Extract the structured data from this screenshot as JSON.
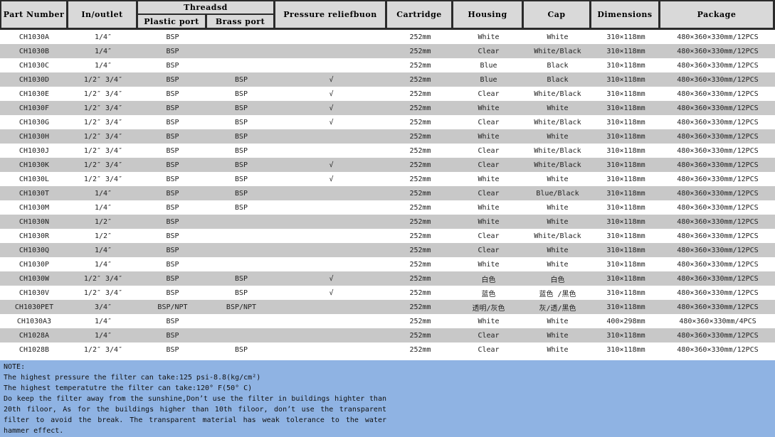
{
  "table": {
    "headers": {
      "part_number": "Part Number",
      "inlet_outlet": "In/outlet",
      "threads_group": "Threadsd",
      "plastic_port": "Plastic port",
      "brass_port": "Brass port",
      "pressure_relief": "Pressure reliefbuon",
      "cartridge": "Cartridge",
      "housing": "Housing",
      "cap": "Cap",
      "dimensions": "Dimensions",
      "package": "Package"
    },
    "rows": [
      {
        "part": "CH1030A",
        "io": "1/4″",
        "plastic": "BSP",
        "brass": "",
        "relief": "",
        "cartridge": "252mm",
        "housing": "White",
        "cap": "White",
        "dimensions": "310×118mm",
        "package": "480×360×330mm/12PCS"
      },
      {
        "part": "CH1030B",
        "io": "1/4″",
        "plastic": "BSP",
        "brass": "",
        "relief": "",
        "cartridge": "252mm",
        "housing": "Clear",
        "cap": "White/Black",
        "dimensions": "310×118mm",
        "package": "480×360×330mm/12PCS"
      },
      {
        "part": "CH1030C",
        "io": "1/4″",
        "plastic": "BSP",
        "brass": "",
        "relief": "",
        "cartridge": "252mm",
        "housing": "Blue",
        "cap": "Black",
        "dimensions": "310×118mm",
        "package": "480×360×330mm/12PCS"
      },
      {
        "part": "CH1030D",
        "io": "1/2″  3/4″",
        "plastic": "BSP",
        "brass": "BSP",
        "relief": "√",
        "cartridge": "252mm",
        "housing": "Blue",
        "cap": "Black",
        "dimensions": "310×118mm",
        "package": "480×360×330mm/12PCS"
      },
      {
        "part": "CH1030E",
        "io": "1/2″  3/4″",
        "plastic": "BSP",
        "brass": "BSP",
        "relief": "√",
        "cartridge": "252mm",
        "housing": "Clear",
        "cap": "White/Black",
        "dimensions": "310×118mm",
        "package": "480×360×330mm/12PCS"
      },
      {
        "part": "CH1030F",
        "io": "1/2″  3/4″",
        "plastic": "BSP",
        "brass": "BSP",
        "relief": "√",
        "cartridge": "252mm",
        "housing": "White",
        "cap": "White",
        "dimensions": "310×118mm",
        "package": "480×360×330mm/12PCS"
      },
      {
        "part": "CH1030G",
        "io": "1/2″  3/4″",
        "plastic": "BSP",
        "brass": "BSP",
        "relief": "√",
        "cartridge": "252mm",
        "housing": "Clear",
        "cap": "White/Black",
        "dimensions": "310×118mm",
        "package": "480×360×330mm/12PCS"
      },
      {
        "part": "CH1030H",
        "io": "1/2″  3/4″",
        "plastic": "BSP",
        "brass": "BSP",
        "relief": "",
        "cartridge": "252mm",
        "housing": "White",
        "cap": "White",
        "dimensions": "310×118mm",
        "package": "480×360×330mm/12PCS"
      },
      {
        "part": "CH1030J",
        "io": "1/2″  3/4″",
        "plastic": "BSP",
        "brass": "BSP",
        "relief": "",
        "cartridge": "252mm",
        "housing": "Clear",
        "cap": "White/Black",
        "dimensions": "310×118mm",
        "package": "480×360×330mm/12PCS"
      },
      {
        "part": "CH1030K",
        "io": "1/2″  3/4″",
        "plastic": "BSP",
        "brass": "BSP",
        "relief": "√",
        "cartridge": "252mm",
        "housing": "Clear",
        "cap": "White/Black",
        "dimensions": "310×118mm",
        "package": "480×360×330mm/12PCS"
      },
      {
        "part": "CH1030L",
        "io": "1/2″  3/4″",
        "plastic": "BSP",
        "brass": "BSP",
        "relief": "√",
        "cartridge": "252mm",
        "housing": "White",
        "cap": "White",
        "dimensions": "310×118mm",
        "package": "480×360×330mm/12PCS"
      },
      {
        "part": "CH1030T",
        "io": "1/4″",
        "plastic": "BSP",
        "brass": "BSP",
        "relief": "",
        "cartridge": "252mm",
        "housing": "Clear",
        "cap": "Blue/Black",
        "dimensions": "310×118mm",
        "package": "480×360×330mm/12PCS"
      },
      {
        "part": "CH1030M",
        "io": "1/4″",
        "plastic": "BSP",
        "brass": "BSP",
        "relief": "",
        "cartridge": "252mm",
        "housing": "White",
        "cap": "White",
        "dimensions": "310×118mm",
        "package": "480×360×330mm/12PCS"
      },
      {
        "part": "CH1030N",
        "io": "1/2″",
        "plastic": "BSP",
        "brass": "",
        "relief": "",
        "cartridge": "252mm",
        "housing": "White",
        "cap": "White",
        "dimensions": "310×118mm",
        "package": "480×360×330mm/12PCS"
      },
      {
        "part": "CH1030R",
        "io": "1/2″",
        "plastic": "BSP",
        "brass": "",
        "relief": "",
        "cartridge": "252mm",
        "housing": "Clear",
        "cap": "White/Black",
        "dimensions": "310×118mm",
        "package": "480×360×330mm/12PCS"
      },
      {
        "part": "CH1030Q",
        "io": "1/4″",
        "plastic": "BSP",
        "brass": "",
        "relief": "",
        "cartridge": "252mm",
        "housing": "Clear",
        "cap": "White",
        "dimensions": "310×118mm",
        "package": "480×360×330mm/12PCS"
      },
      {
        "part": "CH1030P",
        "io": "1/4″",
        "plastic": "BSP",
        "brass": "",
        "relief": "",
        "cartridge": "252mm",
        "housing": "White",
        "cap": "White",
        "dimensions": "310×118mm",
        "package": "480×360×330mm/12PCS"
      },
      {
        "part": "CH1030W",
        "io": "1/2″  3/4″",
        "plastic": "BSP",
        "brass": "BSP",
        "relief": "√",
        "cartridge": "252mm",
        "housing": "白色",
        "cap": "白色",
        "dimensions": "310×118mm",
        "package": "480×360×330mm/12PCS"
      },
      {
        "part": "CH1030V",
        "io": "1/2″  3/4″",
        "plastic": "BSP",
        "brass": "BSP",
        "relief": "√",
        "cartridge": "252mm",
        "housing": "蓝色",
        "cap": "蓝色 /黑色",
        "dimensions": "310×118mm",
        "package": "480×360×330mm/12PCS"
      },
      {
        "part": "CH1030PET",
        "io": "3/4″",
        "plastic": "BSP/NPT",
        "brass": "BSP/NPT",
        "relief": "",
        "cartridge": "252mm",
        "housing": "透明/灰色",
        "cap": "灰/透/黑色",
        "dimensions": "310×118mm",
        "package": "480×360×330mm/12PCS"
      },
      {
        "part": "CH1030A3",
        "io": "1/4″",
        "plastic": "BSP",
        "brass": "",
        "relief": "",
        "cartridge": "252mm",
        "housing": "White",
        "cap": "White",
        "dimensions": "400×298mm",
        "package": "480×360×330mm/4PCS"
      },
      {
        "part": "CH1028A",
        "io": "1/4″",
        "plastic": "BSP",
        "brass": "",
        "relief": "",
        "cartridge": "252mm",
        "housing": "Clear",
        "cap": "White",
        "dimensions": "310×118mm",
        "package": "480×360×330mm/12PCS"
      },
      {
        "part": "CH1028B",
        "io": "1/2″  3/4″",
        "plastic": "BSP",
        "brass": "BSP",
        "relief": "",
        "cartridge": "252mm",
        "housing": "Clear",
        "cap": "White",
        "dimensions": "310×118mm",
        "package": "480×360×330mm/12PCS"
      }
    ]
  },
  "note": {
    "heading": "NOTE:",
    "line1": "The highest pressure the filter can take:125 psi-8.8(kg/cm²)",
    "line2": "The highest temperatutre the filter can take:120° F(50° C)",
    "line3": "Do keep the filter away from the sunshine,Don’t use the filter in buildings highter than 20th filoor, As for the buildings higher than 10th filoor, don’t use the transparent filter to avoid the break. The transparent material has weak tolerance to the water hammer effect."
  },
  "colors": {
    "header_bg": "#d9d9d9",
    "row_alt_bg": "#c8c8c8",
    "note_bg": "#8fb3e3",
    "border": "#2b2b2b"
  }
}
